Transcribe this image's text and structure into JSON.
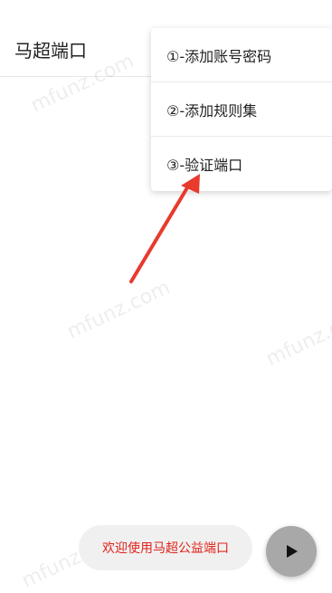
{
  "app": {
    "title": "马超端口"
  },
  "menu": {
    "items": [
      {
        "label": "①-添加账号密码"
      },
      {
        "label": "②-添加规则集"
      },
      {
        "label": "③-验证端口"
      }
    ]
  },
  "toast": {
    "text": "欢迎使用马超公益端口"
  },
  "fab": {
    "icon": "play-icon"
  },
  "watermark": {
    "text": "mfunz.com"
  },
  "colors": {
    "arrow": "#e83a2d",
    "toast_text": "#e0241b",
    "fab_bg": "#a8a8a8"
  }
}
